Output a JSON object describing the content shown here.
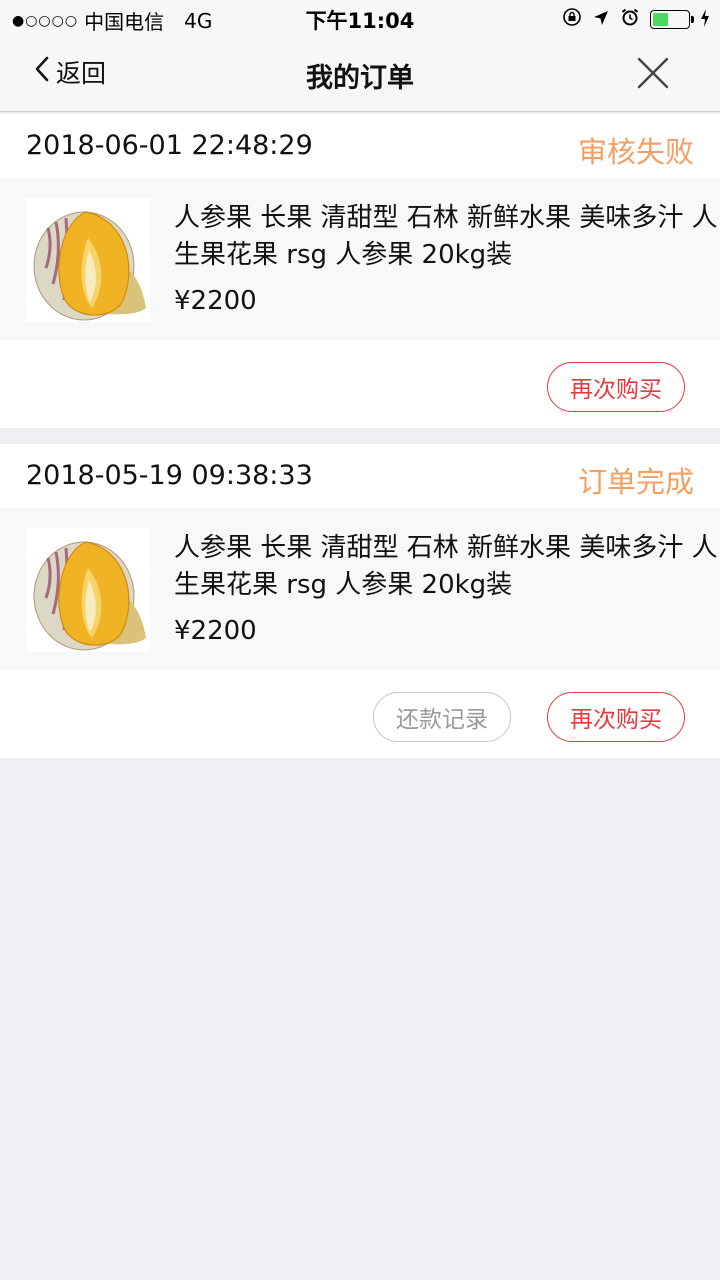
{
  "status_bar": {
    "signal": "●○○○○",
    "carrier": "中国电信",
    "network": "4G",
    "time": "下午11:04",
    "battery_level": 0.45,
    "icons": [
      "orientation-lock-icon",
      "location-arrow-icon",
      "alarm-icon",
      "battery-icon",
      "charging-icon"
    ]
  },
  "nav": {
    "back_label": "返回",
    "title": "我的订单",
    "close_icon": "close-icon"
  },
  "colors": {
    "status_orange": "#f4a063",
    "rebuy_red": "#e8393a",
    "background": "#efeff4"
  },
  "orders": [
    {
      "time": "2018-06-01 22:48:29",
      "status": "审核失败",
      "product_title": "人参果 长果 清甜型 石林 新鲜水果 美味多汁 人生果花果 rsg 人参果 20kg装",
      "price": "¥2200",
      "actions": {
        "rebuy": "再次购买"
      }
    },
    {
      "time": "2018-05-19 09:38:33",
      "status": "订单完成",
      "product_title": "人参果 长果 清甜型 石林 新鲜水果 美味多汁 人生果花果 rsg 人参果 20kg装",
      "price": "¥2200",
      "actions": {
        "repay_record": "还款记录",
        "rebuy": "再次购买"
      }
    }
  ]
}
